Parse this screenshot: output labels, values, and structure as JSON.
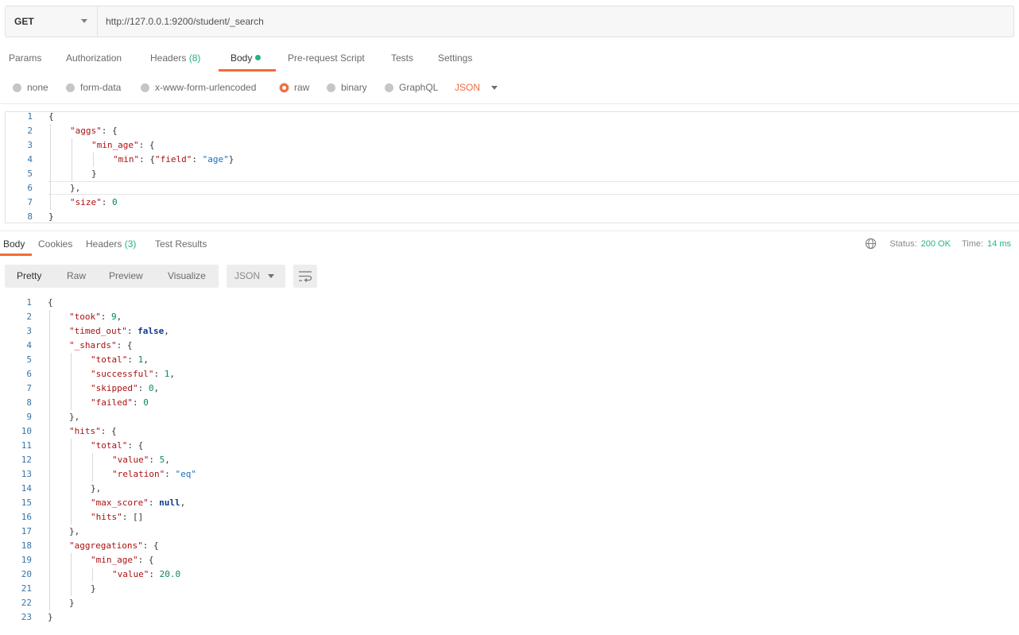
{
  "request": {
    "method": "GET",
    "url": "http://127.0.0.1:9200/student/_search"
  },
  "request_tabs": {
    "params": "Params",
    "authorization": "Authorization",
    "headers": "Headers",
    "headers_count": "(8)",
    "body": "Body",
    "prerequest": "Pre-request Script",
    "tests": "Tests",
    "settings": "Settings"
  },
  "body_types": {
    "none": "none",
    "form_data": "form-data",
    "urlencoded": "x-www-form-urlencoded",
    "raw": "raw",
    "binary": "binary",
    "graphql": "GraphQL",
    "selected": "raw",
    "format": "JSON"
  },
  "request_body": [
    {
      "n": "1",
      "parts": [
        [
          "p",
          "{"
        ]
      ]
    },
    {
      "n": "2",
      "parts": [
        [
          "k",
          "\"aggs\""
        ],
        [
          "p",
          ": {"
        ]
      ]
    },
    {
      "n": "3",
      "parts": [
        [
          "k",
          "\"min_age\""
        ],
        [
          "p",
          ": {"
        ]
      ]
    },
    {
      "n": "4",
      "parts": [
        [
          "k",
          "\"min\""
        ],
        [
          "p",
          ": {"
        ],
        [
          "k",
          "\"field\""
        ],
        [
          "p",
          ": "
        ],
        [
          "s",
          "\"age\""
        ],
        [
          "p",
          "}"
        ]
      ]
    },
    {
      "n": "5",
      "parts": [
        [
          "p",
          "}"
        ]
      ]
    },
    {
      "n": "6",
      "parts": [
        [
          "p",
          "},"
        ]
      ]
    },
    {
      "n": "7",
      "parts": [
        [
          "k",
          "\"size\""
        ],
        [
          "p",
          ": "
        ],
        [
          "n",
          "0"
        ]
      ]
    },
    {
      "n": "8",
      "parts": [
        [
          "p",
          "}"
        ]
      ]
    }
  ],
  "response_tabs": {
    "body": "Body",
    "cookies": "Cookies",
    "headers": "Headers",
    "headers_count": "(3)",
    "test_results": "Test Results"
  },
  "status": {
    "status_label": "Status:",
    "status_value": "200 OK",
    "time_label": "Time:",
    "time_value": "14 ms"
  },
  "response_toolbar": {
    "pretty": "Pretty",
    "raw": "Raw",
    "preview": "Preview",
    "visualize": "Visualize",
    "format": "JSON"
  },
  "response_body": [
    {
      "n": "1",
      "parts": [
        [
          "p",
          "{"
        ]
      ]
    },
    {
      "n": "2",
      "parts": [
        [
          "k",
          "\"took\""
        ],
        [
          "p",
          ": "
        ],
        [
          "n",
          "9"
        ],
        [
          "p",
          ","
        ]
      ]
    },
    {
      "n": "3",
      "parts": [
        [
          "k",
          "\"timed_out\""
        ],
        [
          "p",
          ": "
        ],
        [
          "b",
          "false"
        ],
        [
          "p",
          ","
        ]
      ]
    },
    {
      "n": "4",
      "parts": [
        [
          "k",
          "\"_shards\""
        ],
        [
          "p",
          ": {"
        ]
      ]
    },
    {
      "n": "5",
      "parts": [
        [
          "k",
          "\"total\""
        ],
        [
          "p",
          ": "
        ],
        [
          "n",
          "1"
        ],
        [
          "p",
          ","
        ]
      ]
    },
    {
      "n": "6",
      "parts": [
        [
          "k",
          "\"successful\""
        ],
        [
          "p",
          ": "
        ],
        [
          "n",
          "1"
        ],
        [
          "p",
          ","
        ]
      ]
    },
    {
      "n": "7",
      "parts": [
        [
          "k",
          "\"skipped\""
        ],
        [
          "p",
          ": "
        ],
        [
          "n",
          "0"
        ],
        [
          "p",
          ","
        ]
      ]
    },
    {
      "n": "8",
      "parts": [
        [
          "k",
          "\"failed\""
        ],
        [
          "p",
          ": "
        ],
        [
          "n",
          "0"
        ]
      ]
    },
    {
      "n": "9",
      "parts": [
        [
          "p",
          "},"
        ]
      ]
    },
    {
      "n": "10",
      "parts": [
        [
          "k",
          "\"hits\""
        ],
        [
          "p",
          ": {"
        ]
      ]
    },
    {
      "n": "11",
      "parts": [
        [
          "k",
          "\"total\""
        ],
        [
          "p",
          ": {"
        ]
      ]
    },
    {
      "n": "12",
      "parts": [
        [
          "k",
          "\"value\""
        ],
        [
          "p",
          ": "
        ],
        [
          "n",
          "5"
        ],
        [
          "p",
          ","
        ]
      ]
    },
    {
      "n": "13",
      "parts": [
        [
          "k",
          "\"relation\""
        ],
        [
          "p",
          ": "
        ],
        [
          "s",
          "\"eq\""
        ]
      ]
    },
    {
      "n": "14",
      "parts": [
        [
          "p",
          "},"
        ]
      ]
    },
    {
      "n": "15",
      "parts": [
        [
          "k",
          "\"max_score\""
        ],
        [
          "p",
          ": "
        ],
        [
          "b",
          "null"
        ],
        [
          "p",
          ","
        ]
      ]
    },
    {
      "n": "16",
      "parts": [
        [
          "k",
          "\"hits\""
        ],
        [
          "p",
          ": []"
        ]
      ]
    },
    {
      "n": "17",
      "parts": [
        [
          "p",
          "},"
        ]
      ]
    },
    {
      "n": "18",
      "parts": [
        [
          "k",
          "\"aggregations\""
        ],
        [
          "p",
          ": {"
        ]
      ]
    },
    {
      "n": "19",
      "parts": [
        [
          "k",
          "\"min_age\""
        ],
        [
          "p",
          ": {"
        ]
      ]
    },
    {
      "n": "20",
      "parts": [
        [
          "k",
          "\"value\""
        ],
        [
          "p",
          ": "
        ],
        [
          "n",
          "20.0"
        ]
      ]
    },
    {
      "n": "21",
      "parts": [
        [
          "p",
          "}"
        ]
      ]
    },
    {
      "n": "22",
      "parts": [
        [
          "p",
          "}"
        ]
      ]
    },
    {
      "n": "23",
      "parts": [
        [
          "p",
          "}"
        ]
      ]
    }
  ],
  "colors": {
    "accent": "#f26b3a",
    "success": "#26b47f",
    "json_key": "#a11",
    "json_string": "#1a6fb8",
    "json_number": "#09885a",
    "json_keyword": "#0d3a8c"
  }
}
